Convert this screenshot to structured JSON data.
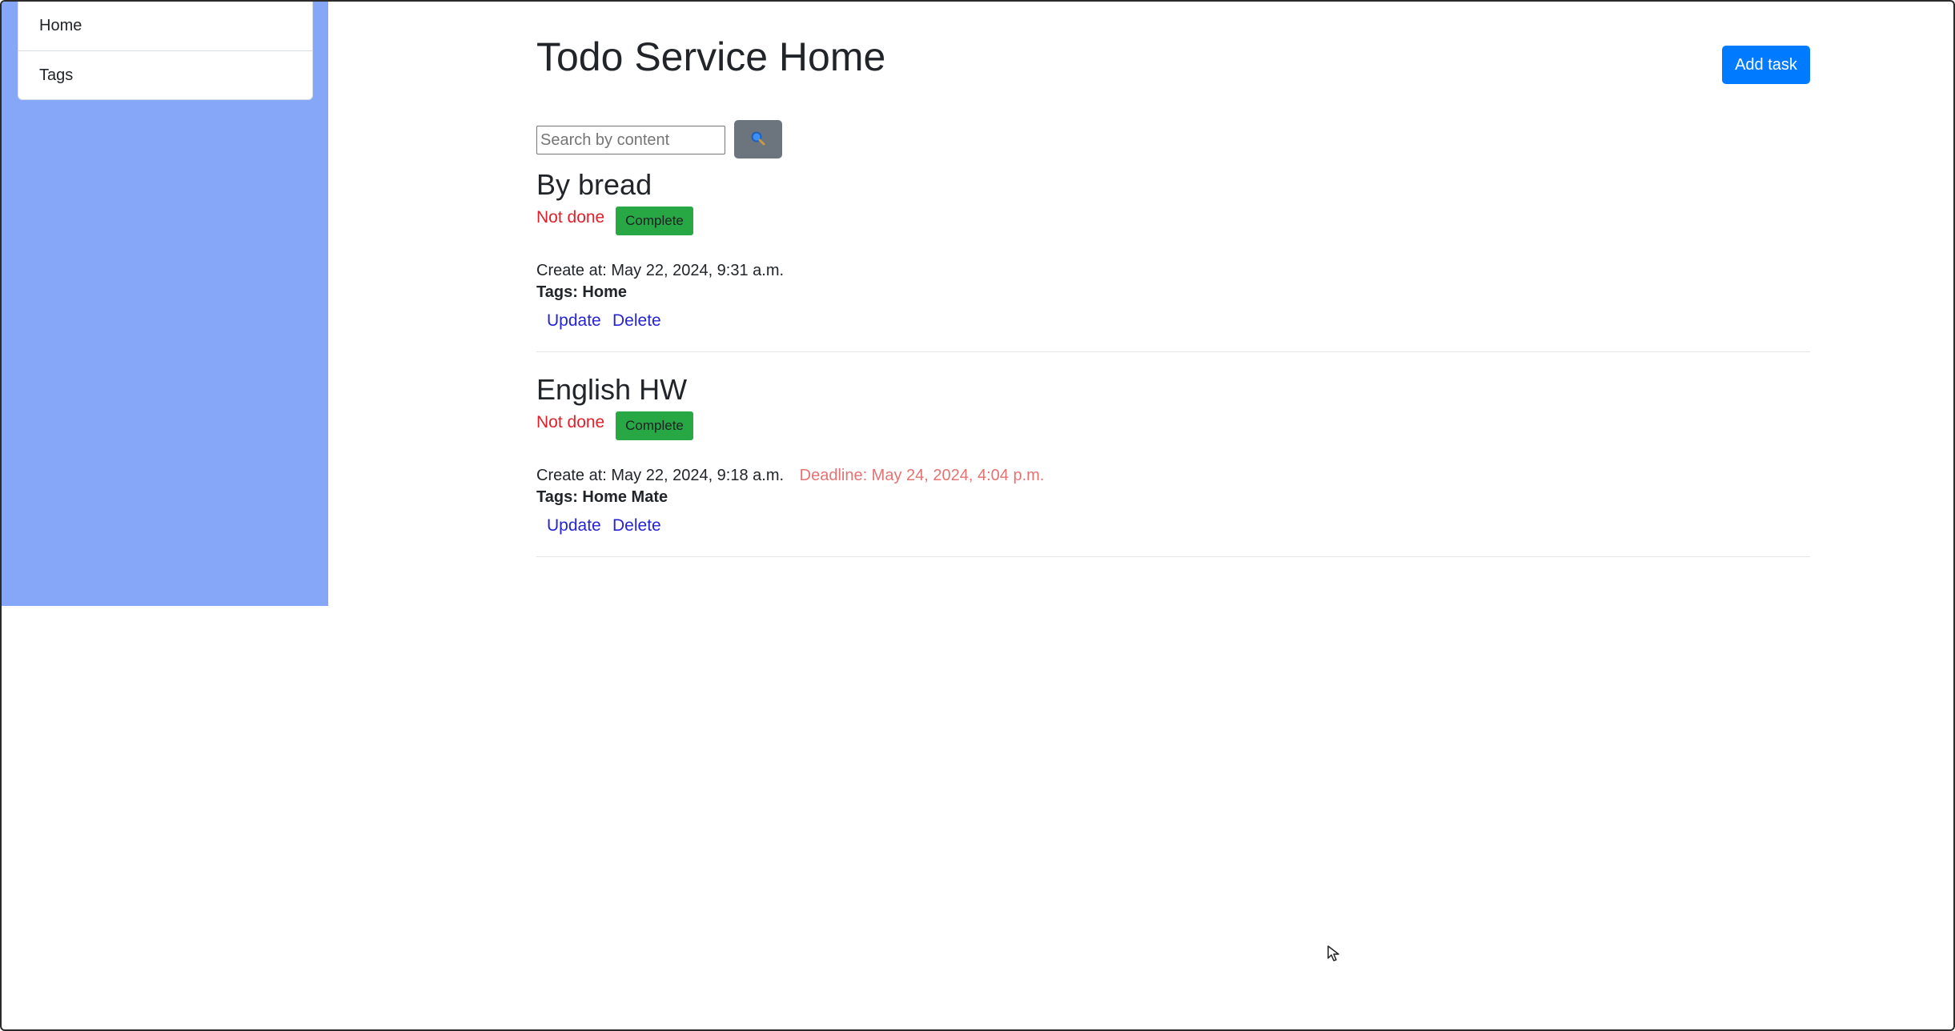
{
  "sidebar": {
    "items": [
      {
        "label": "Home"
      },
      {
        "label": "Tags"
      }
    ]
  },
  "header": {
    "title": "Todo Service Home",
    "add_label": "Add task"
  },
  "search": {
    "placeholder": "Search by content",
    "value": "",
    "button_icon": "search-icon"
  },
  "tasks": [
    {
      "title": "By bread",
      "status": "Not done",
      "complete_label": "Complete",
      "created": "Create at: May 22, 2024, 9:31 a.m.",
      "deadline": "",
      "tags_label": "Tags:",
      "tags": "Home",
      "update_label": "Update",
      "delete_label": "Delete"
    },
    {
      "title": "English HW",
      "status": "Not done",
      "complete_label": "Complete",
      "created": "Create at: May 22, 2024, 9:18 a.m.",
      "deadline": "Deadline: May 24, 2024, 4:04 p.m.",
      "tags_label": "Tags:",
      "tags": "Home Mate",
      "update_label": "Update",
      "delete_label": "Delete"
    }
  ],
  "colors": {
    "sidebar_bg": "#86a6f7",
    "primary": "#007bff",
    "success": "#28a745",
    "secondary": "#6c757d",
    "not_done": "#e0202a",
    "deadline": "#e57373",
    "link": "#2424d6"
  }
}
